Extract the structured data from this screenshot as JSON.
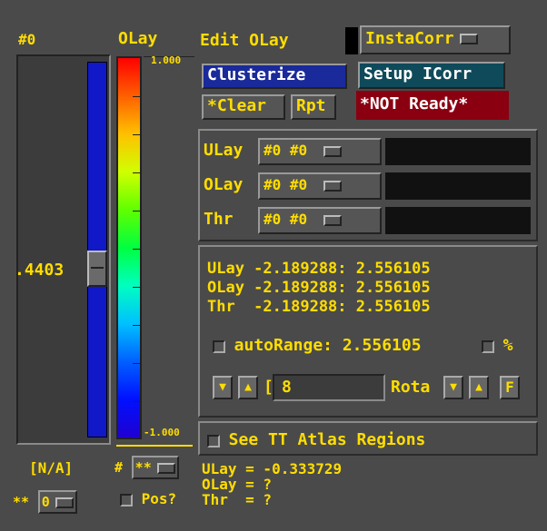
{
  "header": {
    "slice_label": "#0",
    "olay_label": "OLay",
    "edit_olay": "Edit OLay"
  },
  "top_buttons": {
    "insta_corr": "InstaCorr",
    "clusterize": "Clusterize",
    "setup_icorr": "Setup ICorr",
    "clear": "*Clear",
    "rpt": "Rpt",
    "not_ready": "*NOT Ready*"
  },
  "slider": {
    "value_label": ".4403",
    "na_label": "[N/A]",
    "bottom_select": "0",
    "bottom_prefix": "**",
    "position_fraction": 0.555
  },
  "colorbar": {
    "max_label": "1.000",
    "min_label": "-1.000",
    "hash_label": "#",
    "select_value": "**",
    "pos_label": "Pos?"
  },
  "sub_bricks": [
    {
      "label": "ULay",
      "value": "#0 #0"
    },
    {
      "label": "OLay",
      "value": "#0 #0"
    },
    {
      "label": "Thr",
      "value": "#0 #0"
    }
  ],
  "ranges": [
    "ULay -2.189288: 2.556105",
    "OLay -2.189288: 2.556105",
    "Thr  -2.189288: 2.556105"
  ],
  "auto_range": {
    "label": "autoRange: 2.556105",
    "percent": "%"
  },
  "rota": {
    "down_arrow": "▼",
    "up_arrow": "▲",
    "bracket": "[",
    "value": "8",
    "label": "Rota",
    "f_label": "F"
  },
  "atlas": {
    "label": "See TT Atlas Regions"
  },
  "readout": [
    "ULay = -0.333729",
    "OLay = ?",
    "Thr  = ?"
  ],
  "colors": {
    "background": "#4a4a4a",
    "text": "#ffdd00",
    "clusterize_bg": "#1a2a9a",
    "setup_bg": "#0e4a5a",
    "not_ready_bg": "#8a0010",
    "slider_bar": "#1018c8"
  }
}
